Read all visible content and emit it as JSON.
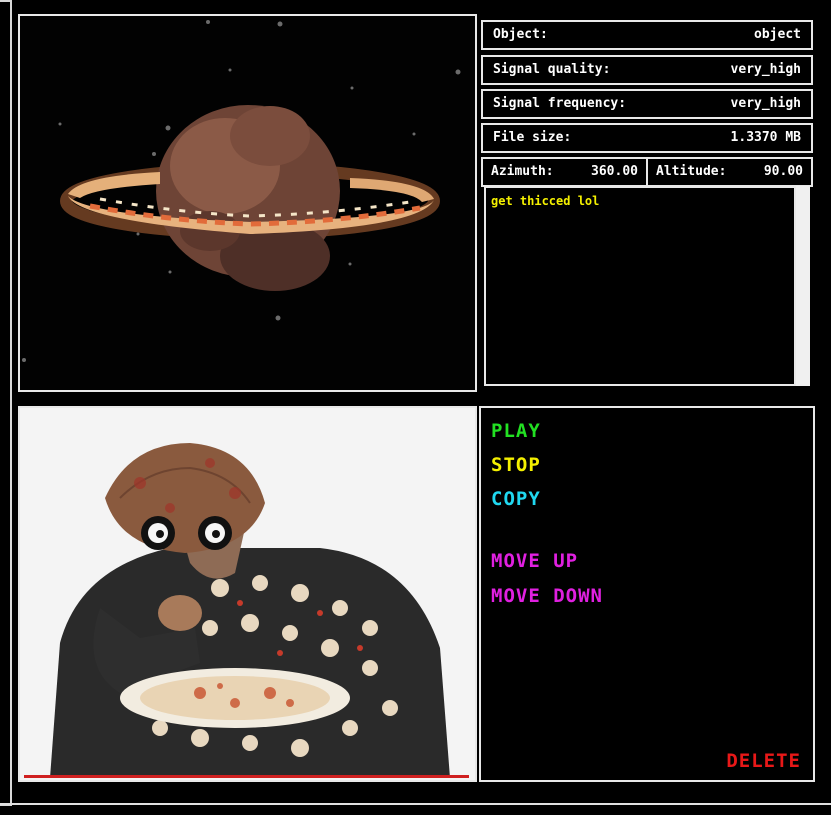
{
  "info": {
    "object_label": "Object:",
    "object_value": "object",
    "signal_quality_label": "Signal quality:",
    "signal_quality_value": "very_high",
    "signal_frequency_label": "Signal frequency:",
    "signal_frequency_value": "very_high",
    "file_size_label": "File size:",
    "file_size_value": "1.3370 MB",
    "azimuth_label": "Azimuth:",
    "azimuth_value": "360.00",
    "altitude_label": "Altitude:",
    "altitude_value": "90.00"
  },
  "message": {
    "text": "get thicced lol"
  },
  "actions": {
    "play": "PLAY",
    "stop": "STOP",
    "copy": "COPY",
    "move_up": "MOVE UP",
    "move_down": "MOVE DOWN",
    "delete": "DELETE"
  },
  "colors": {
    "play": "#22e022",
    "stop": "#f4f000",
    "copy": "#20d8f0",
    "move": "#e020e0",
    "delete": "#e81818",
    "message": "#f4f000"
  },
  "icons": {
    "viewer": "planet-image",
    "photo": "person-eating-image"
  }
}
